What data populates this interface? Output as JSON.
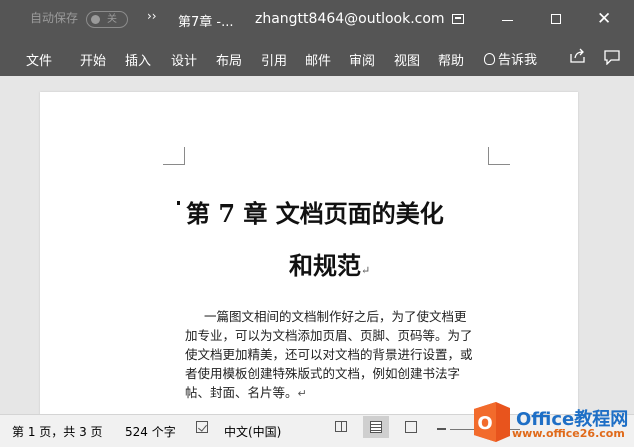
{
  "titlebar": {
    "autosave_label": "自动保存",
    "autosave_state": "关",
    "qat_more": "››",
    "doc_title": "第7章 -...",
    "account": "zhangtt8464@outlook.com",
    "close_glyph": "✕"
  },
  "ribbon": {
    "tabs": [
      "文件",
      "开始",
      "插入",
      "设计",
      "布局",
      "引用",
      "邮件",
      "审阅",
      "视图",
      "帮助"
    ],
    "tell_me": "告诉我"
  },
  "document": {
    "heading_line1": "第 7 章  文档页面的美化",
    "heading_line2": "和规范",
    "paragraph_mark": "↵",
    "body_lines": [
      "一篇图文相间的文档制作好之后，为了使文档更",
      "加专业，可以为文档添加页眉、页脚、页码等。为了",
      "使文档更加精美，还可以对文档的背景进行设置，或",
      "者使用模板创建特殊版式的文档，例如创建书法字",
      "帖、封面、名片等。"
    ]
  },
  "statusbar": {
    "page_info": "第 1 页，共 3 页",
    "word_count": "524 个字",
    "language": "中文(中国)"
  },
  "watermark": {
    "logo_letter": "O",
    "brand": "Office教程网",
    "url": "www.office26.com"
  },
  "colors": {
    "titlebar_bg": "#555555",
    "statusbar_bg": "#f1f1f1",
    "canvas_bg": "#e6e6e6",
    "brand_orange": "#e8541d",
    "brand_blue": "#1e6fc6"
  }
}
